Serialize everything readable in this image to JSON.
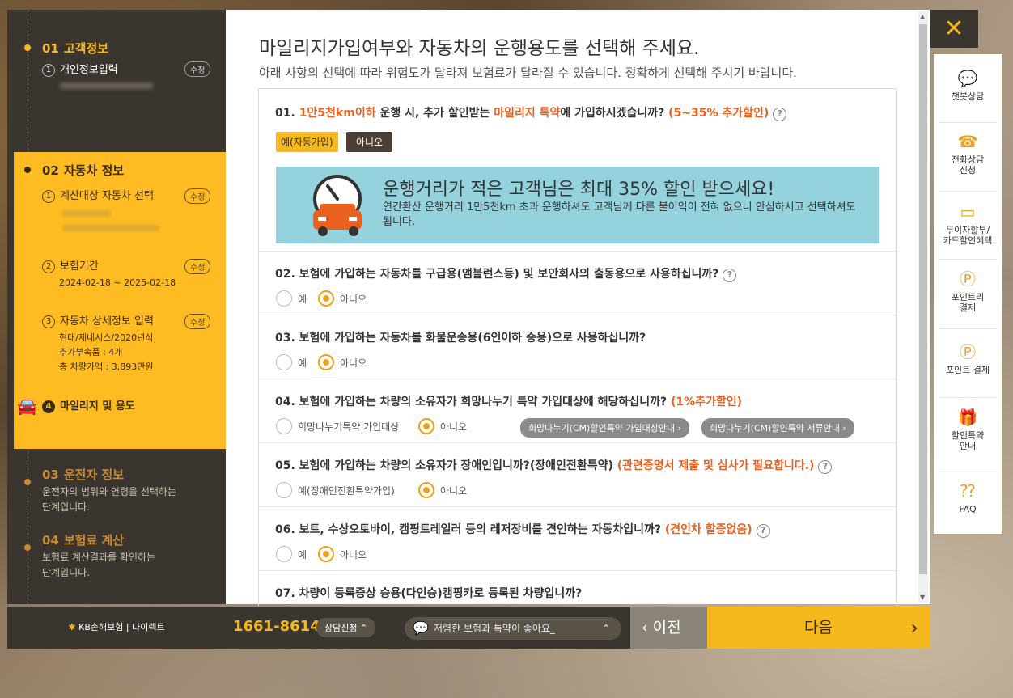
{
  "sidebar": {
    "step1": {
      "num": "01",
      "title": "고객정보",
      "sub": "개인정보입력",
      "sub_num": "1",
      "edit": "수정"
    },
    "step2": {
      "num": "02",
      "title": "자동차 정보",
      "items": [
        {
          "num": "1",
          "label": "계산대상 자동차 선택",
          "edit": "수정"
        },
        {
          "num": "2",
          "label": "보험기간",
          "edit": "수정",
          "detail": "2024-02-18 ~ 2025-02-18"
        },
        {
          "num": "3",
          "label": "자동차 상세정보 입력",
          "edit": "수정",
          "detail1": "현대/제네시스/2020년식",
          "detail2": "추가부속품 : 4개",
          "detail3": "총 차량가액 : 3,893만원"
        },
        {
          "num": "4",
          "label": "마일리지 및 용도"
        }
      ]
    },
    "step3": {
      "num": "03",
      "title": "운전자 정보",
      "desc1": "운전자의 범위와 연령을 선택하는",
      "desc2": "단계입니다."
    },
    "step4": {
      "num": "04",
      "title": "보험료 계산",
      "desc1": "보험료 계산결과를 확인하는",
      "desc2": "단계입니다."
    }
  },
  "main": {
    "title": "마일리지가입여부와 자동차의 운행용도를 선택해 주세요.",
    "subtitle": "아래 사항의 선택에 따라 위험도가 달라져 보험료가 달라질 수 있습니다. 정확하게 선택해 주시기 바랍니다.",
    "q1": {
      "p1": "01. ",
      "o1": "1만5천km이하",
      "p2": " 운행 시, 추가 할인받는 ",
      "o2": "마일리지 특약",
      "p3": "에 가입하시겠습니까? ",
      "o3": "(5~35% 추가할인)",
      "yes": "예(자동가입)",
      "no": "아니오"
    },
    "banner": {
      "title": "운행거리가 적은 고객님은 최대 35% 할인 받으세요!",
      "desc": "연간환산 운행거리 1만5천km 초과 운행하셔도 고객님께 다른 불이익이 전혀 없으니 안심하시고 선택하셔도 됩니다."
    },
    "q2": {
      "text": "02. 보험에 가입하는 자동차를 구급용(앰블런스등) 및 보안회사의 출동용으로 사용하십니까?",
      "yes": "예",
      "no": "아니오"
    },
    "q3": {
      "text": "03. 보험에 가입하는 자동차를 화물운송용(6인이하 승용)으로 사용하십니까?",
      "yes": "예",
      "no": "아니오"
    },
    "q4": {
      "text": "04. 보험에 가입하는 차량의 소유자가 희망나누기 특약 가입대상에 해당하십니까? ",
      "o": "(1%추가할인)",
      "yes": "희망나누기특약 가입대상",
      "no": "아니오",
      "pill1": "희망나누기(CM)할인특약 가입대상안내 ›",
      "pill2": "희망나누기(CM)할인특약 서류안내 ›"
    },
    "q5": {
      "text": "05. 보험에 가입하는 차량의 소유자가 장애인입니까?(장애인전환특약) ",
      "o": "(관련증명서 제출 및 심사가 필요합니다.)",
      "yes": "예(장애인전환특약가입)",
      "no": "아니오"
    },
    "q6": {
      "text": "06. 보트, 수상오토바이, 캠핑트레일러 등의 레저장비를 견인하는 자동차입니까? ",
      "o": "(견인차 할증없음)",
      "yes": "예",
      "no": "아니오"
    },
    "q7": {
      "text": "07. 차량이 등록증상 승용(다인승)캠핑카로 등록된 차량입니까?"
    },
    "help": "?"
  },
  "right_panel": [
    {
      "label1": "챗봇상담",
      "label2": "",
      "icon": "chatbot-icon"
    },
    {
      "label1": "전화상담",
      "label2": "신청",
      "icon": "phone-icon"
    },
    {
      "label1": "무이자할부/",
      "label2": "카드할인혜택",
      "icon": "card-icon"
    },
    {
      "label1": "포인트리",
      "label2": "결제",
      "icon": "pointree-icon"
    },
    {
      "label1": "포인트 결제",
      "label2": "",
      "icon": "point-icon"
    },
    {
      "label1": "할인특약",
      "label2": "안내",
      "icon": "gift-icon"
    },
    {
      "label1": "FAQ",
      "label2": "",
      "icon": "faq-icon"
    }
  ],
  "bottom": {
    "logo": "KB손해보험 | 다이렉트",
    "phone": "1661-8614",
    "consult": "상담신청 ⌃",
    "chat": "저렴한 보험과 특약이 좋아요_",
    "prev": "이전",
    "next": "다음"
  },
  "colors": {
    "accent": "#f5b91e",
    "dark": "#3a352e",
    "orange": "#e8611f"
  }
}
